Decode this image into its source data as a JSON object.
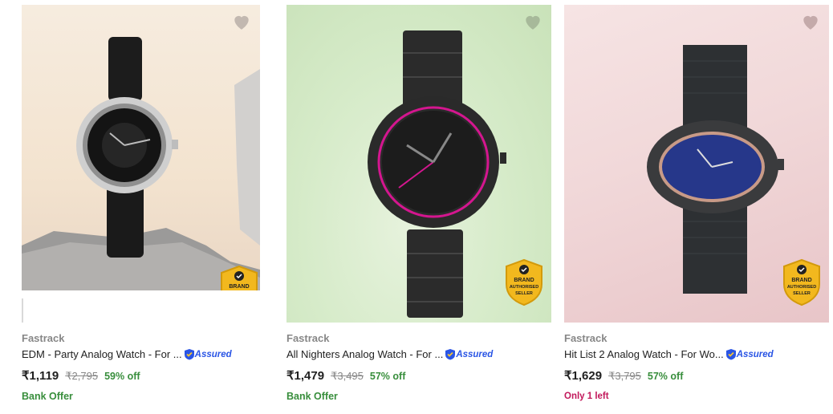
{
  "products": [
    {
      "brand": "Fastrack",
      "title": "EDM - Party Analog Watch - For ...",
      "assured_label": "Assured",
      "price": "₹1,119",
      "mrp": "₹2,795",
      "discount": "59% off",
      "extra": "Bank Offer",
      "badge_lines": [
        "BRAND"
      ],
      "image_icon": "black-leather-strap-watch-image"
    },
    {
      "brand": "Fastrack",
      "title": "All Nighters Analog Watch - For ...",
      "assured_label": "Assured",
      "price": "₹1,479",
      "mrp": "₹3,495",
      "discount": "57% off",
      "extra": "Bank Offer",
      "badge_lines": [
        "BRAND",
        "AUTHORISED",
        "SELLER"
      ],
      "image_icon": "black-metal-strap-watch-image"
    },
    {
      "brand": "Fastrack",
      "title": "Hit List 2 Analog Watch - For Wo...",
      "assured_label": "Assured",
      "price": "₹1,629",
      "mrp": "₹3,795",
      "discount": "57% off",
      "extra": "Only 1 left",
      "badge_lines": [
        "BRAND",
        "AUTHORISED",
        "SELLER"
      ],
      "image_icon": "oval-mesh-strap-watch-image"
    }
  ],
  "colors": {
    "discount_green": "#388e3c",
    "assured_blue": "#2a55e5",
    "low_stock_pink": "#c2185b",
    "badge_gold": "#f2b81e"
  }
}
